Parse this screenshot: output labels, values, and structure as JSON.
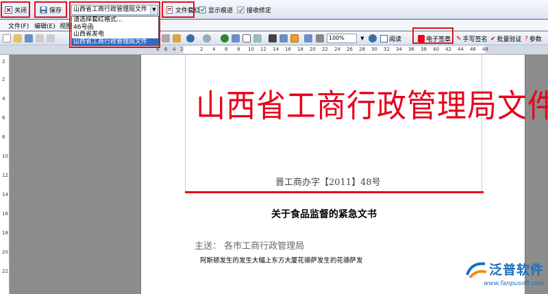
{
  "toolbar": {
    "close_label": "关闭",
    "save_label": "保存",
    "template_selected": "山西省工商行政管理局文件",
    "apply_template_label": "文件套红",
    "show_marks_label": "显示痕迹",
    "accept_changes_label": "接收修定"
  },
  "template_dropdown": {
    "options": [
      "请选择套红格式...",
      "46号函",
      "山西省发电",
      "山西省工商行政管理局文件"
    ]
  },
  "menubar": {
    "items": [
      "文件(F)",
      "编辑(E)",
      "视图"
    ]
  },
  "format_toolbar": {
    "zoom": "100%",
    "read_label": "阅读",
    "e_seal_label": "电子签章",
    "handwrite_label": "手写签名",
    "batch_verify_label": "批量验证",
    "params_label": "参数"
  },
  "ruler": {
    "ticks": [
      "8",
      "6",
      "4",
      "2",
      "2",
      "4",
      "6",
      "8",
      "10",
      "12",
      "14",
      "16",
      "18",
      "20",
      "22",
      "24",
      "26",
      "28",
      "30",
      "32",
      "34",
      "36",
      "38",
      "40",
      "42",
      "44",
      "46",
      "48"
    ]
  },
  "vruler": {
    "ticks": [
      "2",
      "2",
      "4",
      "6",
      "8",
      "10",
      "12",
      "14",
      "16",
      "18",
      "20",
      "22"
    ]
  },
  "document": {
    "title": "山西省工商行政管理局文件",
    "doc_number": "晋工商办字【2011】48号",
    "subject": "关于食品监督的紧急文书",
    "recipients_label": "主送：",
    "recipients": "各市工商行政管理局",
    "body": "阿斯顿发生的发生大幅上东方大厦花德萨发生的花德萨发"
  },
  "logo": {
    "name": "泛普软件",
    "url": "www.fanpusoft.com"
  },
  "colors": {
    "accent_red": "#e8001c",
    "highlight": "#e0101a",
    "brand_blue": "#1b6fc1"
  }
}
